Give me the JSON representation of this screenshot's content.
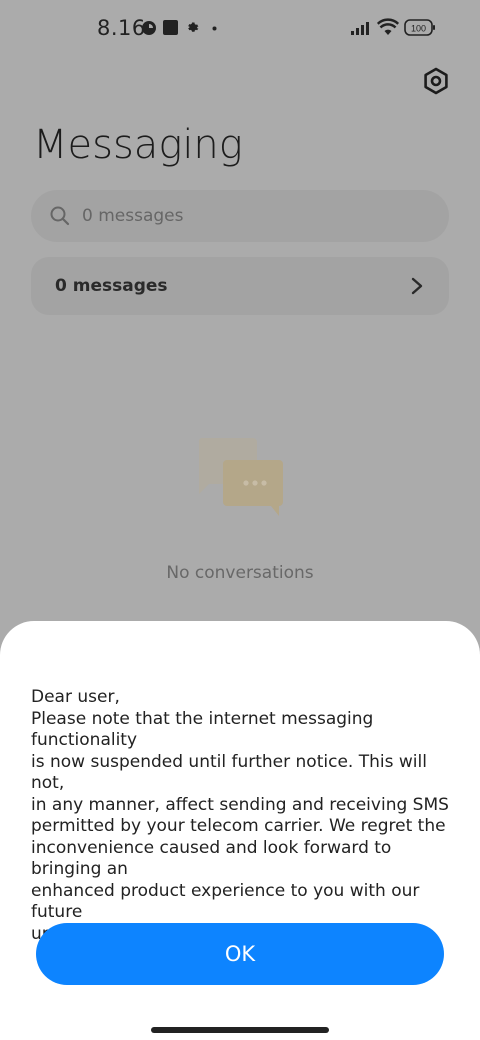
{
  "status_bar": {
    "time": "8.16",
    "battery": "100",
    "icons": [
      "notification-circle-icon",
      "square-icon",
      "gear-small-icon",
      "dot-icon",
      "signal-icon",
      "wifi-icon",
      "battery-icon"
    ]
  },
  "header": {
    "title": "Messaging",
    "settings_icon": "settings-hex-icon"
  },
  "search": {
    "placeholder": "0 messages",
    "icon": "search-icon"
  },
  "messages_row": {
    "label": "0 messages",
    "icon": "chevron-right-icon"
  },
  "empty_state": {
    "icon": "chat-bubbles-icon",
    "text": "No conversations"
  },
  "dialog": {
    "message": "Dear user,\nPlease note that the internet messaging functionality\nis now suspended until further notice. This will not,\nin any manner, affect sending and receiving SMS\npermitted by your telecom carrier. We regret the\ninconvenience caused and look forward to bringing an\nenhanced product experience to you with our future\nupdates.",
    "ok_label": "OK"
  },
  "colors": {
    "scrim_background": "#ababab",
    "accent": "#0d84ff",
    "sheet": "#ffffff"
  }
}
